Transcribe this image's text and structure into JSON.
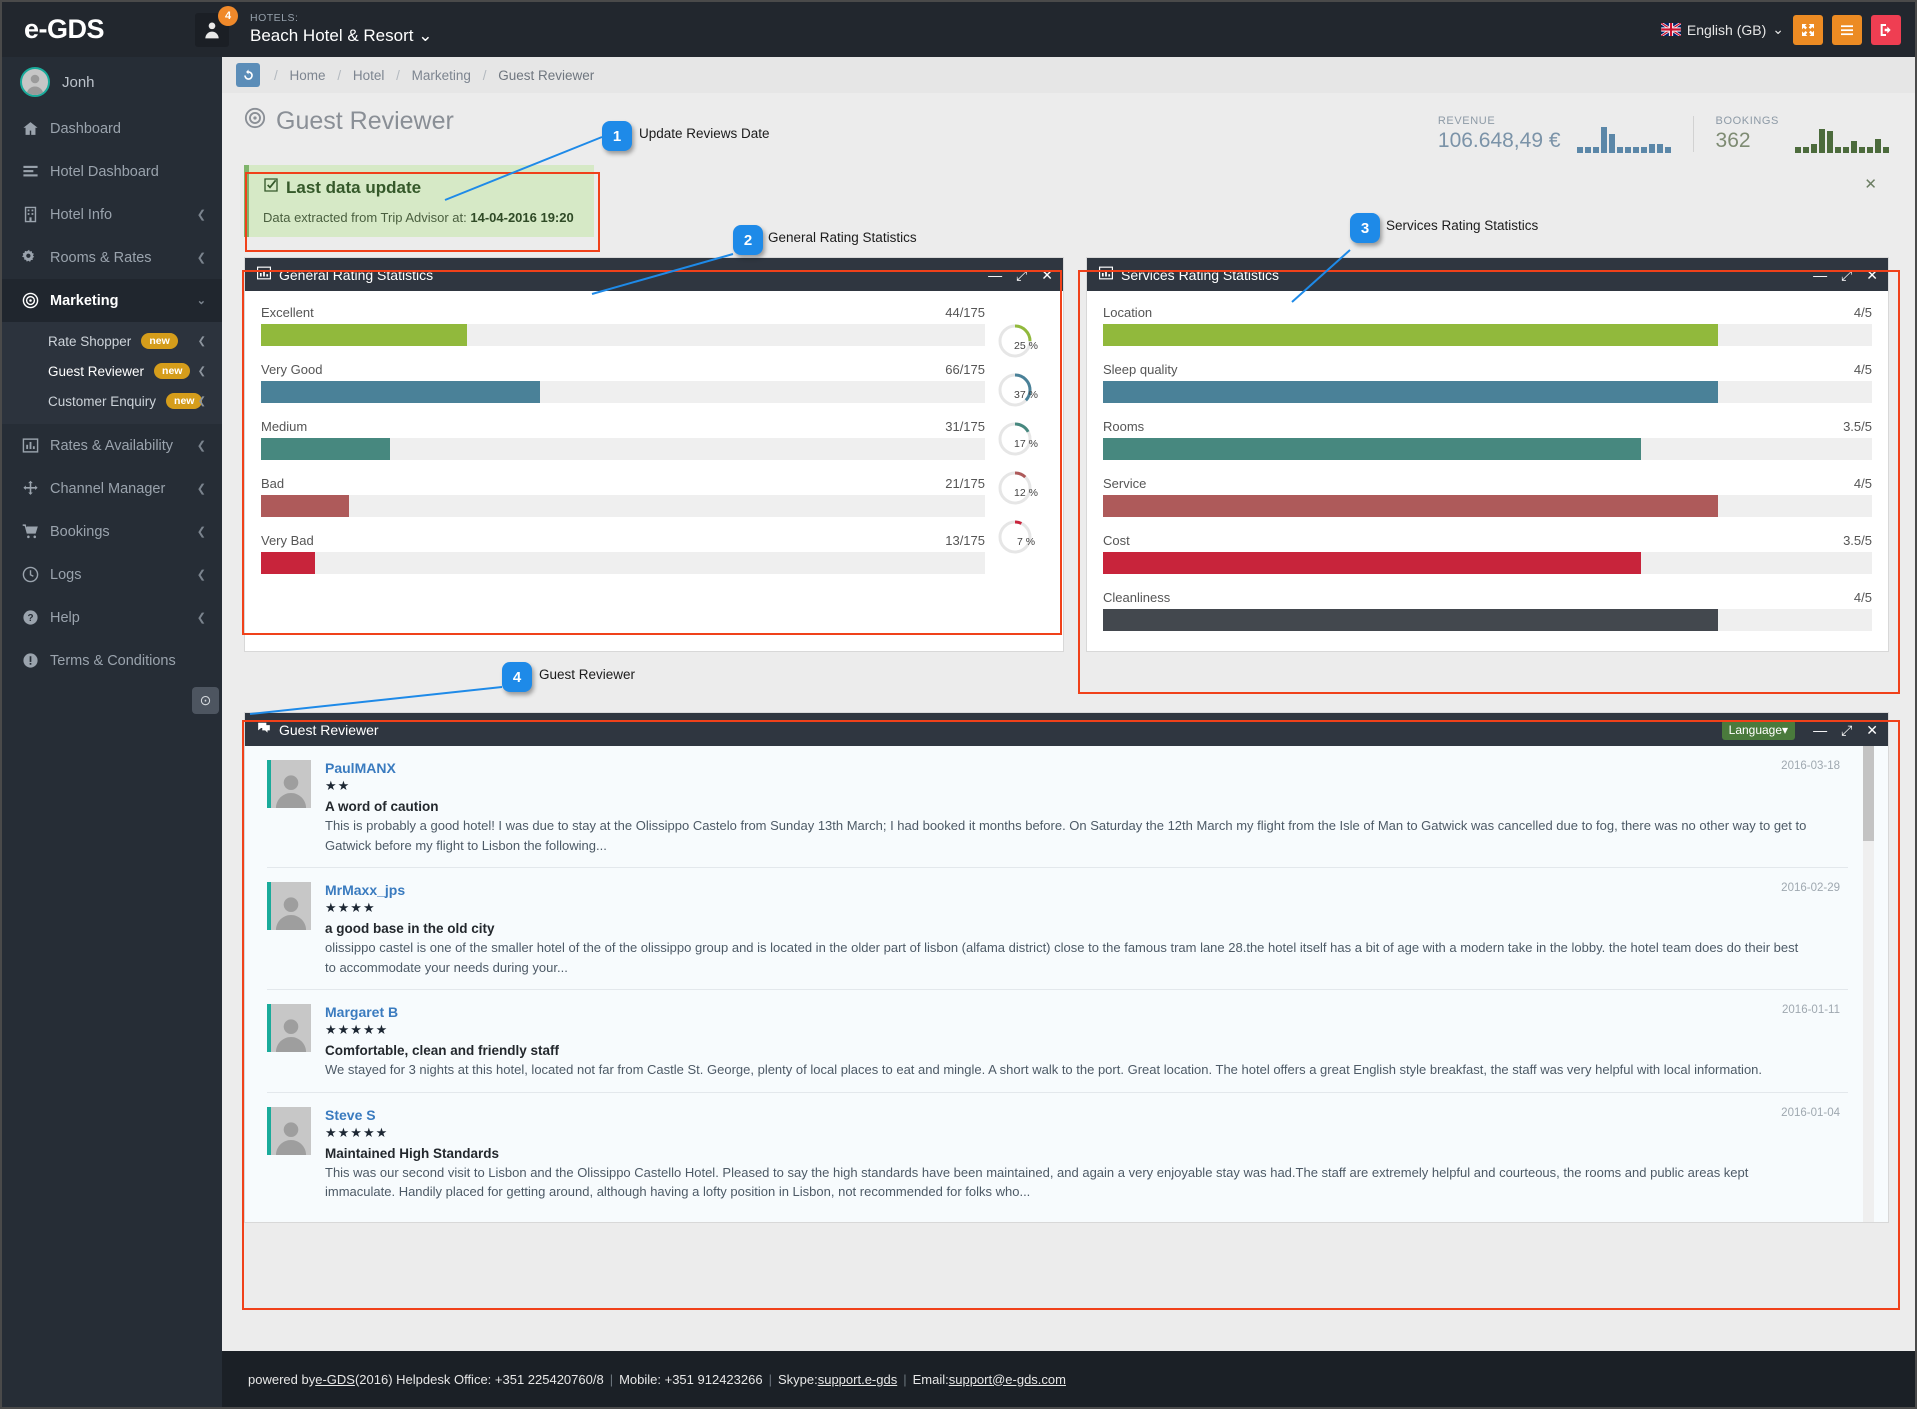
{
  "topbar": {
    "logo": "e-GDS",
    "notification_count": "4",
    "hotels_label": "HOTELS:",
    "hotel_name": "Beach Hotel & Resort",
    "hotel_caret": "⌄",
    "language": "English (GB)",
    "language_caret": "⌄",
    "buttons": [
      {
        "name": "fullscreen-button",
        "icon": "expand-icon"
      },
      {
        "name": "menu-toggle-button",
        "icon": "hamburger-icon"
      },
      {
        "name": "logout-button",
        "icon": "logout-icon"
      }
    ]
  },
  "sidebar": {
    "user": "Jonh",
    "items": [
      {
        "label": "Dashboard",
        "icon": "home-icon",
        "active": false,
        "caret": ""
      },
      {
        "label": "Hotel Dashboard",
        "icon": "list-icon",
        "active": false,
        "caret": ""
      },
      {
        "label": "Hotel Info",
        "icon": "building-icon",
        "active": false,
        "caret": "❮"
      },
      {
        "label": "Rooms & Rates",
        "icon": "gears-icon",
        "active": false,
        "caret": "❮"
      },
      {
        "label": "Marketing",
        "icon": "target-icon",
        "active": true,
        "caret": "⌄"
      }
    ],
    "subitems": [
      {
        "label": "Rate Shopper",
        "tag": "new",
        "caret": "❮",
        "active": false
      },
      {
        "label": "Guest Reviewer",
        "tag": "new",
        "caret": "❮",
        "active": true
      },
      {
        "label": "Customer Enquiry",
        "tag": "new",
        "caret": "❮",
        "active": false
      }
    ],
    "items_after": [
      {
        "label": "Rates & Availability",
        "icon": "bars-chart-icon",
        "caret": "❮"
      },
      {
        "label": "Channel Manager",
        "icon": "arrows-icon",
        "caret": "❮"
      },
      {
        "label": "Bookings",
        "icon": "cart-icon",
        "caret": "❮"
      },
      {
        "label": "Logs",
        "icon": "clock-icon",
        "caret": "❮"
      },
      {
        "label": "Help",
        "icon": "question-icon",
        "caret": "❮"
      },
      {
        "label": "Terms & Conditions",
        "icon": "info-icon",
        "caret": ""
      }
    ],
    "collapse_icon": "chevron-left-circle-icon"
  },
  "breadcrumb": {
    "refresh_icon": "refresh-icon",
    "items": [
      "Home",
      "Hotel",
      "Marketing",
      "Guest Reviewer"
    ]
  },
  "page": {
    "title": "Guest Reviewer",
    "title_icon": "target-icon"
  },
  "kpis": {
    "revenue_label": "REVENUE",
    "revenue_value": "106.648,49 €",
    "bookings_label": "BOOKINGS",
    "bookings_value": "362",
    "revenue_color": "#5b87a8",
    "bookings_color": "#4c6b3c",
    "revenue_spark": [
      6,
      6,
      6,
      26,
      19,
      6,
      6,
      6,
      6,
      9,
      9,
      6
    ],
    "bookings_spark": [
      6,
      6,
      9,
      24,
      22,
      6,
      6,
      12,
      6,
      6,
      14,
      6
    ]
  },
  "alert": {
    "icon": "check-square-icon",
    "title": "Last data update",
    "text_prefix": "Data extracted from Trip Advisor at: ",
    "date": "14-04-2016 19:20",
    "close_icon": "close-icon"
  },
  "general_panel": {
    "title": "General Rating Statistics",
    "icon": "bar-chart-icon",
    "tools": [
      "minimize-icon",
      "expand-icon",
      "close-icon"
    ]
  },
  "services_panel": {
    "title": "Services Rating Statistics",
    "icon": "bar-chart-icon",
    "tools": [
      "minimize-icon",
      "expand-icon",
      "close-icon"
    ]
  },
  "reviews_panel": {
    "title": "Guest Reviewer",
    "icon": "comments-icon",
    "language_button": "Language",
    "language_caret": "▾",
    "tools": [
      "minimize-icon",
      "expand-icon",
      "close-icon"
    ]
  },
  "chart_data": [
    {
      "type": "bar",
      "title": "General Rating Statistics",
      "orientation": "horizontal",
      "xlabel": "",
      "ylabel": "",
      "total": 175,
      "categories": [
        "Excellent",
        "Very Good",
        "Medium",
        "Bad",
        "Very Bad"
      ],
      "values": [
        44,
        66,
        31,
        21,
        13
      ],
      "value_labels": [
        "44/175",
        "66/175",
        "31/175",
        "21/175",
        "13/175"
      ],
      "percent_labels": [
        "25 %",
        "37 %",
        "17 %",
        "12 %",
        "7 %"
      ],
      "percents": [
        25,
        37,
        17,
        12,
        7
      ],
      "bar_fill_pct": [
        28.5,
        38.5,
        17.8,
        12.2,
        7.5
      ],
      "colors": [
        "#91b93c",
        "#4a8198",
        "#47887f",
        "#ae5a5a",
        "#c8243b"
      ]
    },
    {
      "type": "bar",
      "title": "Services Rating Statistics",
      "orientation": "horizontal",
      "xlabel": "",
      "ylabel": "",
      "scale_max": 5,
      "categories": [
        "Location",
        "Sleep quality",
        "Rooms",
        "Service",
        "Cost",
        "Cleanliness"
      ],
      "values": [
        4,
        4,
        3.5,
        4,
        3.5,
        4
      ],
      "value_labels": [
        "4/5",
        "4/5",
        "3.5/5",
        "4/5",
        "3.5/5",
        "4/5"
      ],
      "bar_fill_pct": [
        80,
        80,
        70,
        80,
        70,
        80
      ],
      "colors": [
        "#91b93c",
        "#4a8198",
        "#47887f",
        "#ae5a5a",
        "#c8243b",
        "#43484e"
      ]
    }
  ],
  "reviews": [
    {
      "author": "PaulMANX",
      "stars": 2,
      "stars_glyphs": "★★",
      "date": "2016-03-18",
      "title": "A word of caution",
      "text": "This is probably a good hotel! I was due to stay at the Olissippo Castelo from Sunday 13th March; I had booked it months before. On Saturday the 12th March my flight from the Isle of Man to Gatwick was cancelled due to fog, there was no other way to get to Gatwick before my flight to Lisbon the following..."
    },
    {
      "author": "MrMaxx_jps",
      "stars": 4,
      "stars_glyphs": "★★★★",
      "date": "2016-02-29",
      "title": "a good base in the old city",
      "text": "olissippo castel is one of the smaller hotel of the of the olissippo group and is located in the older part of lisbon (alfama district) close to the famous tram lane 28.the hotel itself has a bit of age with a modern take in the lobby. the hotel team does do their best to accommodate your needs during your..."
    },
    {
      "author": "Margaret B",
      "stars": 5,
      "stars_glyphs": "★★★★★",
      "date": "2016-01-11",
      "title": "Comfortable, clean and friendly staff",
      "text": "We stayed for 3 nights at this hotel, located not far from Castle St. George, plenty of local places to eat and mingle. A short walk to the port. Great location. The hotel offers a great English style breakfast, the staff was very helpful with local information."
    },
    {
      "author": "Steve S",
      "stars": 5,
      "stars_glyphs": "★★★★★",
      "date": "2016-01-04",
      "title": "Maintained High Standards",
      "text": "This was our second visit to Lisbon and the Olissippo Castello Hotel. Pleased to say the high standards have been maintained, and again a very enjoyable stay was had.The staff are extremely helpful and courteous, the rooms and public areas kept immaculate. Handily placed for getting around, although having a lofty position in Lisbon, not recommended for folks who..."
    }
  ],
  "annotations": [
    {
      "number": "1",
      "label": "Update Reviews Date"
    },
    {
      "number": "2",
      "label": "General Rating Statistics"
    },
    {
      "number": "3",
      "label": "Services Rating Statistics"
    },
    {
      "number": "4",
      "label": "Guest Reviewer"
    }
  ],
  "footer": {
    "powered_by": "powered by ",
    "brand": "e-GDS",
    "year": " (2016) Helpdesk Office: +351 225420760/8",
    "mobile": "Mobile: +351 912423266",
    "skype_label": "Skype: ",
    "skype": "support.e-gds",
    "email_label": "Email: ",
    "email": "support@e-gds.com"
  }
}
